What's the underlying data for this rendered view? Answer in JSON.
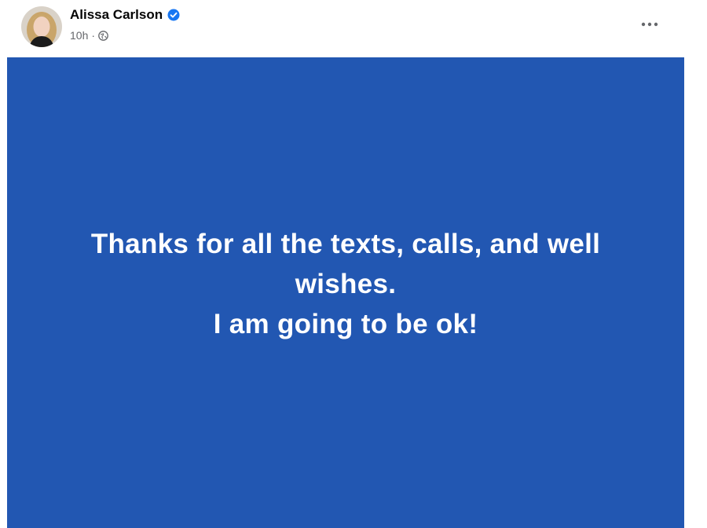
{
  "post": {
    "author": {
      "name": "Alissa Carlson",
      "verified_icon": "verified-badge-icon",
      "avatar_icon": "profile-photo"
    },
    "meta": {
      "timestamp": "10h",
      "separator": "·",
      "audience_icon": "globe-icon"
    },
    "menu_icon": "more-options-icon",
    "background_color": "#2257b2",
    "text_lines": [
      "Thanks for all the texts, calls, and well wishes.",
      "I am going to be ok!"
    ]
  }
}
